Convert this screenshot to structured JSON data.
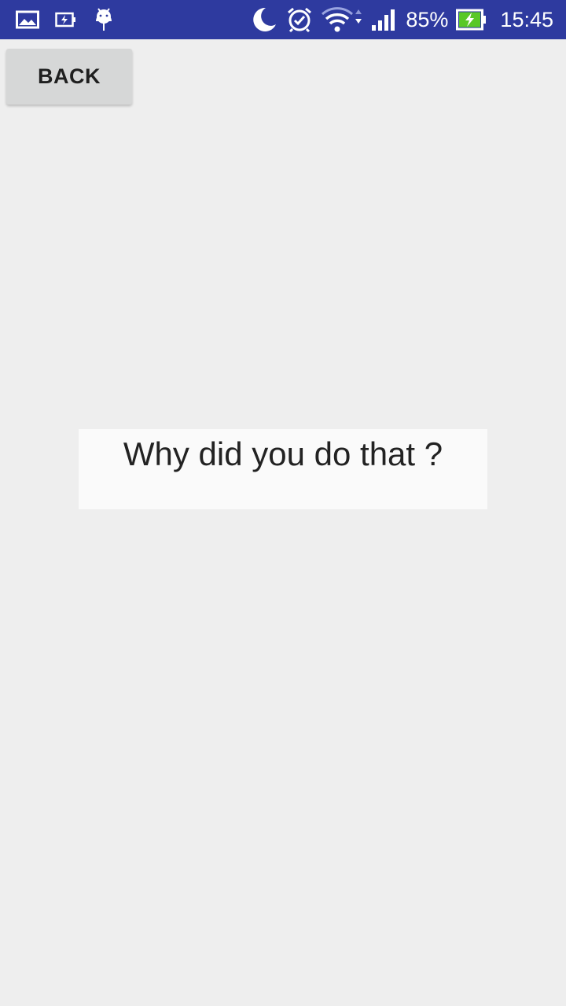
{
  "status_bar": {
    "left_icons": [
      "gallery-icon",
      "battery-saver-icon",
      "android-debug-icon"
    ],
    "right_icons": [
      "moon-icon",
      "alarm-icon",
      "wifi-icon",
      "signal-icon",
      "battery-charging-icon"
    ],
    "battery_percent": "85%",
    "time": "15:45",
    "background_color": "#2e3a9f",
    "battery_fill_color": "#58c828"
  },
  "toolbar": {
    "back_label": "BACK"
  },
  "main": {
    "message": "Why did you do that ?"
  }
}
